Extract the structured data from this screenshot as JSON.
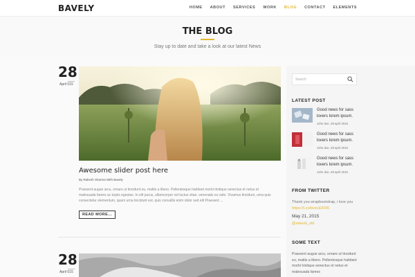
{
  "header": {
    "logo": "BAVELY",
    "menu": [
      "HOME",
      "ABOUT",
      "SERVICES",
      "WORK",
      "BLOG",
      "CONTACT",
      "ELEMENTS"
    ],
    "active": "BLOG",
    "accent_color": "#e4b72c"
  },
  "hero": {
    "title": "THE BLOG",
    "subtitle": "Stay up to date and take a look at our latest News"
  },
  "posts": [
    {
      "day": "28",
      "month": "April 015",
      "title": "Awesome slider post here",
      "meta": "By Rakesh Sharma With Bavely",
      "excerpt": "Praesent augue arcu, ornare ut tincidunt eu, mattis a libero. Pellentesque habitant morbi tristique senectus et netus et malesuada fames ac turpis egestas. In elit purus, ullamcorper vel luctus vitae, venenatis eu odio. Vivamus tincidunt, urna quis consectetur elementum, quam urna tincidunt est, quis convallis enim dolor sed elit Praesent ...",
      "read_more": "READ MORE..."
    },
    {
      "day": "28",
      "month": "April 015"
    }
  ],
  "sidebar": {
    "search_placeholder": "Search",
    "latest_heading": "LATEST POST",
    "latest": [
      {
        "title": "Good news for sass lovers lorem ipsum.",
        "meta": "John doe, 28 april 2015"
      },
      {
        "title": "Good news for sass lovers lorem ipsum.",
        "meta": "John doe, 28 april 2015"
      },
      {
        "title": "Good news for sass lovers lorem ipsum.",
        "meta": "John doe, 28 april 2015"
      }
    ],
    "twitter_heading": "FROM TWITTER",
    "tweet_text": "Thank you wrapbootstrap, i love you",
    "tweet_link": "https://t.co/bvecEIFR5",
    "tweet_date": "May 21, 2015",
    "tweet_handle": "@rakesh_std",
    "some_text_heading": "SOME TEXT",
    "some_text": "Praesent augue arcu, ornare ut tincidunt eu, mattis a libero. Pellentesque habitant morbi tristique senectus et netus et malesuada fames"
  }
}
